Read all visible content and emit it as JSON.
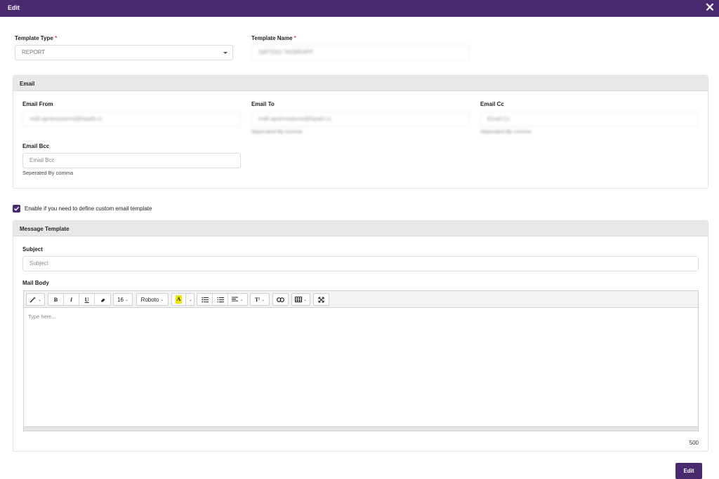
{
  "titlebar": {
    "title": "Edit"
  },
  "template_type": {
    "label": "Template Type",
    "required_mark": "*",
    "value": "REPORT"
  },
  "template_name": {
    "label": "Template Name",
    "required_mark": "*",
    "value": "SMTSSO TADBRAPP"
  },
  "email_panel": {
    "heading": "Email",
    "from": {
      "label": "Email From",
      "value": "mdfi.apnlmctdoms@fopafo.ci"
    },
    "to": {
      "label": "Email To",
      "value": "mdfi.apnlmctdoms@fopafo.ci",
      "helper": "Seperated By comma"
    },
    "cc": {
      "label": "Email Cc",
      "placeholder": "Email Cc",
      "helper": "Seperated By comma"
    },
    "bcc": {
      "label": "Email Bcc",
      "placeholder": "Email Bcc",
      "helper": "Seperated By comma"
    }
  },
  "custom_template_checkbox": {
    "label": "Enable if you need to define custom email template",
    "checked": true
  },
  "message_panel": {
    "heading": "Message Template",
    "subject": {
      "label": "Subject",
      "placeholder": "Subject"
    },
    "mail_body": {
      "label": "Mail Body",
      "placeholder": "Type here...",
      "font_size": "16",
      "font_family": "Roboto",
      "toolbar_icons": [
        "magic-wand-icon",
        "bold-icon",
        "italic-icon",
        "underline-icon",
        "eraser-icon",
        "font-size-select",
        "font-family-select",
        "text-color-icon",
        "unordered-list-icon",
        "ordered-list-icon",
        "align-icon",
        "text-style-icon",
        "link-icon",
        "table-icon",
        "fullscreen-icon"
      ]
    },
    "char_count": "500"
  },
  "submit": {
    "label": "Edit"
  },
  "colors": {
    "accent": "#4a2a6e",
    "panel_header": "#e6e8ea",
    "highlight": "#f5e600"
  }
}
